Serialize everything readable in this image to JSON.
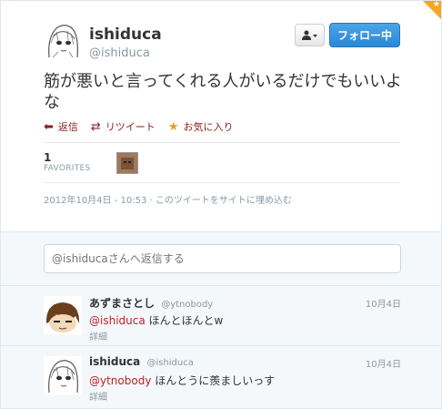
{
  "user": {
    "name": "ishiduca",
    "handle": "@ishiduca"
  },
  "buttons": {
    "follow_label": "フォロー中"
  },
  "tweet": {
    "text": "筋が悪いと言ってくれる人がいるだけでもいいよな"
  },
  "actions": {
    "reply_label": "返信",
    "retweet_label": "リツイート",
    "favorite_label": "お気に入り"
  },
  "stats": {
    "favorites_count": "1",
    "favorites_label": "FAVORITES"
  },
  "timestamp": "2012年10月4日 - 10:53 · このツイートをサイトに埋め込む",
  "reply_box": {
    "placeholder": "@ishiducaさんへ返信する"
  },
  "replies": [
    {
      "name": "あずまさとし",
      "handle": "@ytnobody",
      "time": "10月4日",
      "mention": "@ishiduca",
      "text": "ほんとほんとw",
      "detail": "詳細"
    },
    {
      "name": "ishiduca",
      "handle": "@ishiduca",
      "time": "10月4日",
      "mention": "@ytnobody",
      "text": "ほんとうに羨ましいっす",
      "detail": "詳細"
    }
  ],
  "colors": {
    "accent": "#2a87d4",
    "mention": "#c0202a",
    "corner": "#f5a623"
  }
}
